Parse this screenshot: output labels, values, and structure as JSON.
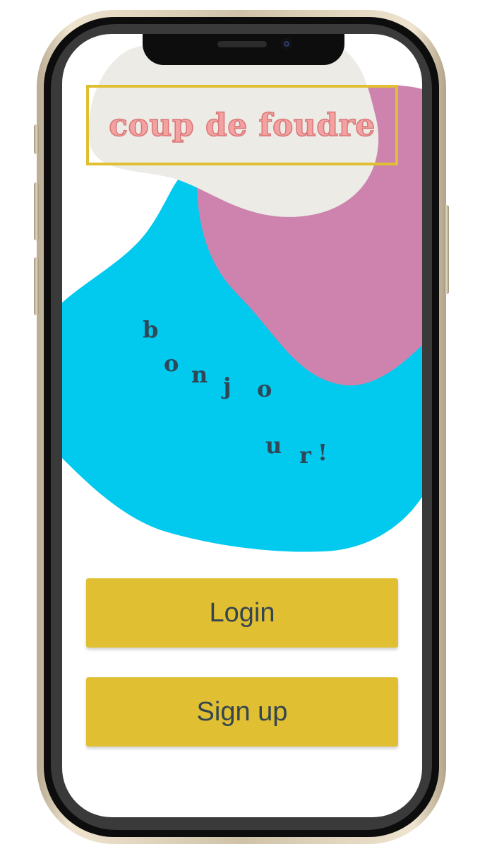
{
  "app": {
    "title": "coup de foudre"
  },
  "greeting": {
    "letters": [
      "b",
      "o",
      "n",
      "j",
      "o",
      "u",
      "r",
      "!"
    ]
  },
  "actions": {
    "login_label": "Login",
    "signup_label": "Sign up"
  },
  "colors": {
    "accent": "#e1bf33",
    "blob_cyan": "#02c9ee",
    "blob_pink": "#cd83ae",
    "blob_cream": "#ecebe6",
    "title_pink": "#f3a1a1",
    "text_dark": "#2f4858"
  }
}
